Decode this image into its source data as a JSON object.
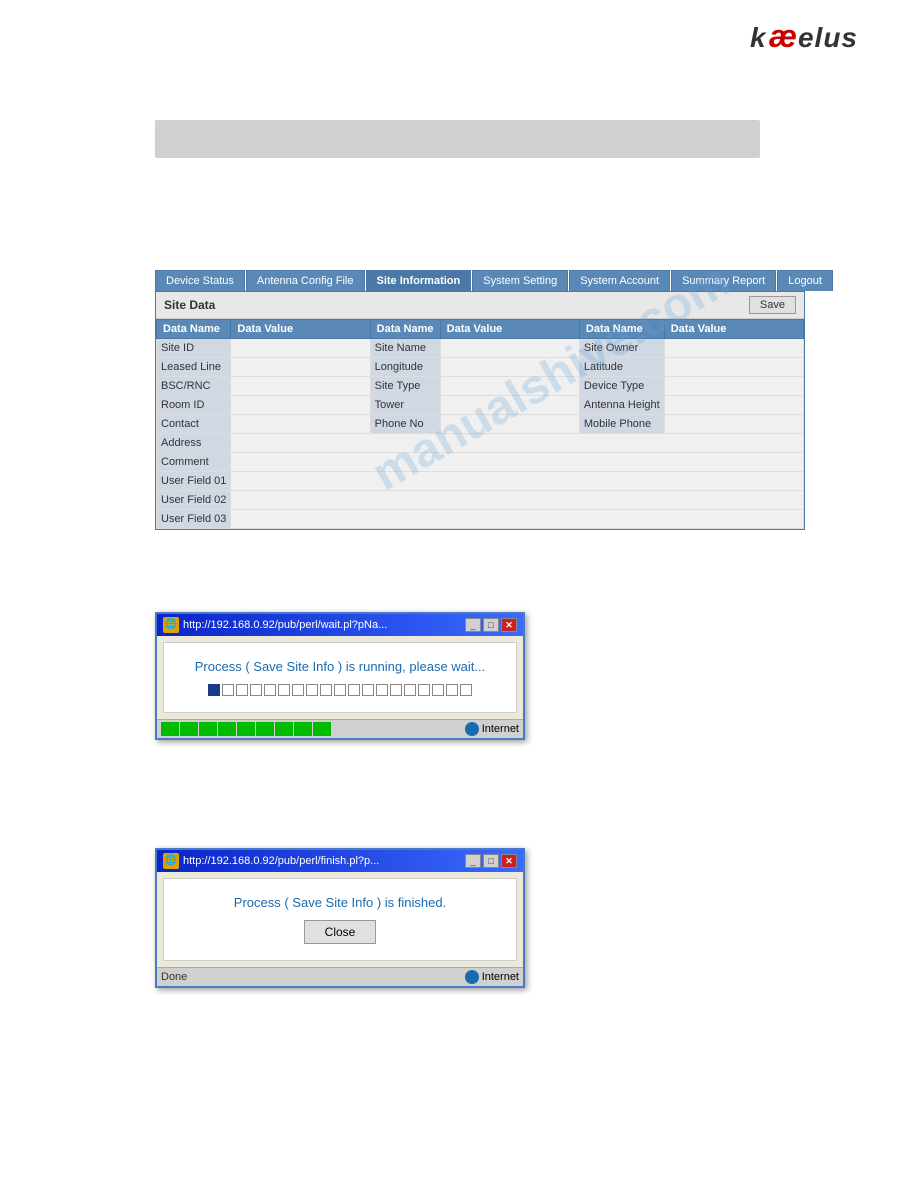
{
  "logo": {
    "text_k": "k",
    "text_slash": "æ",
    "text_rest": "elus"
  },
  "gray_bar": {},
  "nav": {
    "tabs": [
      {
        "label": "Device Status",
        "active": false
      },
      {
        "label": "Antenna Config File",
        "active": false
      },
      {
        "label": "Site Information",
        "active": true
      },
      {
        "label": "System Setting",
        "active": false
      },
      {
        "label": "System Account",
        "active": false
      },
      {
        "label": "Summary Report",
        "active": false
      },
      {
        "label": "Logout",
        "active": false
      }
    ]
  },
  "site_data": {
    "title": "Site Data",
    "save_label": "Save",
    "columns": [
      "Data Name",
      "Data Value",
      "Data Name",
      "Data Value",
      "Data Name",
      "Data Value"
    ],
    "rows": [
      [
        {
          "label": "Site ID",
          "value": ""
        },
        {
          "label": "Site Name",
          "value": ""
        },
        {
          "label": "Site Owner",
          "value": ""
        }
      ],
      [
        {
          "label": "Leased Line",
          "value": ""
        },
        {
          "label": "Longitude",
          "value": ""
        },
        {
          "label": "Latitude",
          "value": ""
        }
      ],
      [
        {
          "label": "BSC/RNC",
          "value": ""
        },
        {
          "label": "Site Type",
          "value": ""
        },
        {
          "label": "Device Type",
          "value": ""
        }
      ],
      [
        {
          "label": "Room ID",
          "value": ""
        },
        {
          "label": "Tower",
          "value": ""
        },
        {
          "label": "Antenna Height",
          "value": ""
        }
      ],
      [
        {
          "label": "Contact",
          "value": ""
        },
        {
          "label": "Phone No",
          "value": ""
        },
        {
          "label": "Mobile Phone",
          "value": ""
        }
      ]
    ],
    "wide_rows": [
      {
        "label": "Address",
        "value": ""
      },
      {
        "label": "Comment",
        "value": ""
      },
      {
        "label": "User Field 01",
        "value": ""
      },
      {
        "label": "User Field 02",
        "value": ""
      },
      {
        "label": "User Field 03",
        "value": ""
      }
    ]
  },
  "watermark": "manualshive.com",
  "popup_wait": {
    "title": "http://192.168.0.92/pub/perl/wait.pl?pNa...",
    "message": "Process ( Save Site Info ) is running, please wait...",
    "progress_filled": 1,
    "progress_empty": 18,
    "status_internet": "Internet",
    "progress_green_blocks": 9
  },
  "popup_finish": {
    "title": "http://192.168.0.92/pub/perl/finish.pl?p...",
    "message": "Process ( Save Site Info ) is finished.",
    "close_label": "Close",
    "done_label": "Done",
    "status_internet": "Internet"
  }
}
